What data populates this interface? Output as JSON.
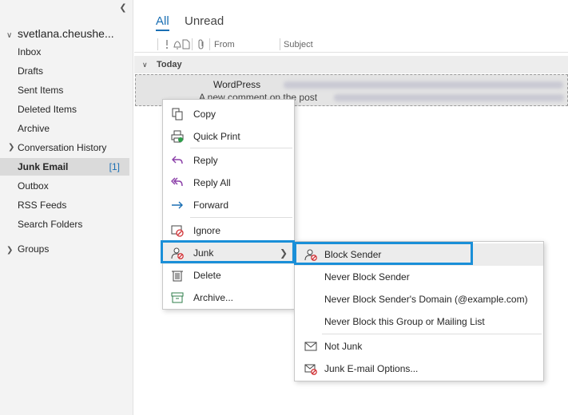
{
  "sidebar": {
    "account": "svetlana.cheushe...",
    "folders": [
      "Inbox",
      "Drafts",
      "Sent Items",
      "Deleted Items",
      "Archive",
      "Conversation History",
      "Junk Email",
      "Outbox",
      "RSS Feeds",
      "Search Folders"
    ],
    "junk_count": "[1]",
    "groups": "Groups"
  },
  "list": {
    "tabs": [
      "All",
      "Unread"
    ],
    "columns": {
      "from": "From",
      "subject": "Subject"
    },
    "group_header": "Today",
    "message": {
      "from": "WordPress",
      "preview": "A new comment on the post"
    }
  },
  "context_menu": {
    "items": [
      "Copy",
      "Quick Print",
      "Reply",
      "Reply All",
      "Forward",
      "Ignore",
      "Junk",
      "Delete",
      "Archive..."
    ]
  },
  "junk_submenu": {
    "items": [
      "Block Sender",
      "Never Block Sender",
      "Never Block Sender's Domain (@example.com)",
      "Never Block this Group or Mailing List",
      "Not Junk",
      "Junk E-mail Options..."
    ]
  },
  "colors": {
    "accent": "#1a6fb4",
    "highlight_border": "#1a8fd8",
    "selected_folder": "#dadada"
  },
  "icons": [
    "collapse-icon",
    "copy-icon",
    "print-icon",
    "reply-icon",
    "reply-all-icon",
    "forward-icon",
    "ignore-icon",
    "junk-icon",
    "delete-icon",
    "archive-icon",
    "block-sender-icon",
    "not-junk-icon",
    "junk-options-icon"
  ]
}
